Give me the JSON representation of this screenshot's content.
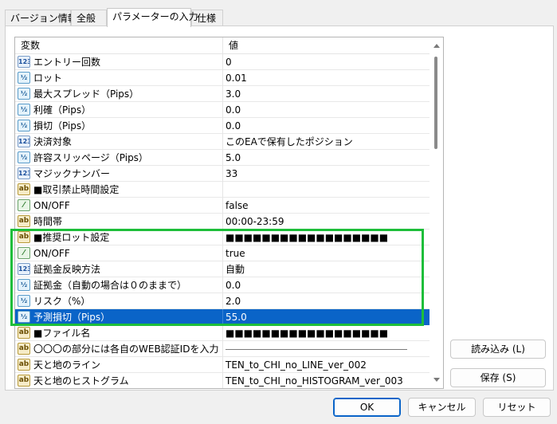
{
  "tabs": [
    {
      "label": "バージョン情報"
    },
    {
      "label": "全般"
    },
    {
      "label": "パラメーターの入力"
    },
    {
      "label": "仕様"
    }
  ],
  "grid": {
    "header_variable": "変数",
    "header_value": "値",
    "rows": [
      {
        "icon": "123",
        "name": "エントリー回数",
        "value": "0"
      },
      {
        "icon": "½",
        "name": "ロット",
        "value": "0.01"
      },
      {
        "icon": "½",
        "name": "最大スプレッド（Pips）",
        "value": "3.0"
      },
      {
        "icon": "½",
        "name": "利確（Pips）",
        "value": "0.0"
      },
      {
        "icon": "½",
        "name": "損切（Pips）",
        "value": "0.0"
      },
      {
        "icon": "123",
        "name": "決済対象",
        "value": "このEAで保有したポジション"
      },
      {
        "icon": "½",
        "name": "許容スリッページ（Pips）",
        "value": "5.0"
      },
      {
        "icon": "123",
        "name": "マジックナンバー",
        "value": "33"
      },
      {
        "icon": "ab",
        "name": "■取引禁止時間設定",
        "value": ""
      },
      {
        "icon": "tf",
        "name": "ON/OFF",
        "value": "false"
      },
      {
        "icon": "ab",
        "name": "時間帯",
        "value": "00:00-23:59"
      },
      {
        "icon": "ab",
        "name": "■推奨ロット設定",
        "value": "■■■■■■■■■■■■■■■■■■"
      },
      {
        "icon": "tf",
        "name": "ON/OFF",
        "value": "true"
      },
      {
        "icon": "123",
        "name": "証拠金反映方法",
        "value": "自動"
      },
      {
        "icon": "½",
        "name": "証拠金（自動の場合は０のままで）",
        "value": "0.0"
      },
      {
        "icon": "½",
        "name": "リスク（%）",
        "value": "2.0"
      },
      {
        "icon": "½",
        "name": "予測損切（Pips）",
        "value": "55.0",
        "selected": true
      },
      {
        "icon": "ab",
        "name": "■ファイル名",
        "value": "■■■■■■■■■■■■■■■■■■"
      },
      {
        "icon": "ab",
        "name": "〇〇〇の部分には各自のWEB認証IDを入力",
        "value": "",
        "line": true
      },
      {
        "icon": "ab",
        "name": "天と地のライン",
        "value": "TEN_to_CHI_no_LINE_ver_002"
      },
      {
        "icon": "ab",
        "name": "天と地のヒストグラム",
        "value": "TEN_to_CHI_no_HISTOGRAM_ver_003"
      }
    ]
  },
  "side_buttons": {
    "load": "読み込み (L)",
    "save": "保存 (S)"
  },
  "footer_buttons": {
    "ok": "OK",
    "cancel": "キャンセル",
    "reset": "リセット"
  },
  "colors": {
    "selection": "#0a64c8",
    "highlight_box": "#1ebe3a"
  }
}
